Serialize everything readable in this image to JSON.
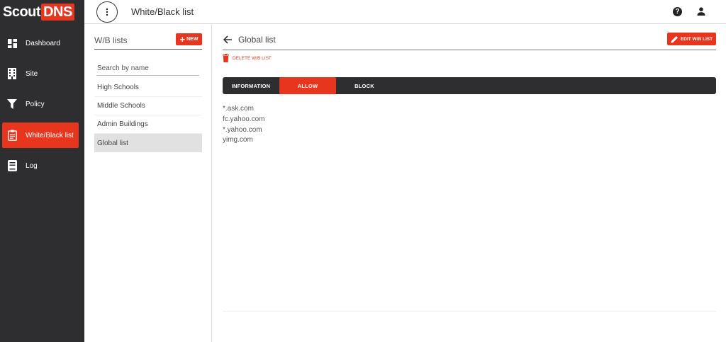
{
  "app": {
    "logo_part1": "Scout",
    "logo_part2": "DNS",
    "page_title": "White/Black list"
  },
  "sidebar": {
    "items": [
      {
        "label": "Dashboard",
        "icon": "dashboard-icon",
        "active": false
      },
      {
        "label": "Site",
        "icon": "building-icon",
        "active": false
      },
      {
        "label": "Policy",
        "icon": "filter-icon",
        "active": false
      },
      {
        "label": "White/Black list",
        "icon": "clipboard-list-icon",
        "active": true
      },
      {
        "label": "Log",
        "icon": "book-icon",
        "active": false
      }
    ]
  },
  "lists_panel": {
    "title": "W/B lists",
    "new_label": "NEW",
    "search_placeholder": "Search by name",
    "items": [
      "High Schools",
      "Middle Schools",
      "Admin Buildings",
      "Global list"
    ],
    "selected": "Global list"
  },
  "detail": {
    "title": "Global list",
    "edit_label": "EDIT W/B LIST",
    "delete_label": "DELETE W/B LIST",
    "tabs": [
      "INFORMATION",
      "ALLOW",
      "BLOCK"
    ],
    "active_tab": "ALLOW",
    "domains": [
      "*.ask.com",
      "fc.yahoo.com",
      "*.yahoo.com",
      "yimg.com"
    ]
  },
  "colors": {
    "accent": "#e8351e",
    "sidebar_bg": "#2e2e30"
  }
}
